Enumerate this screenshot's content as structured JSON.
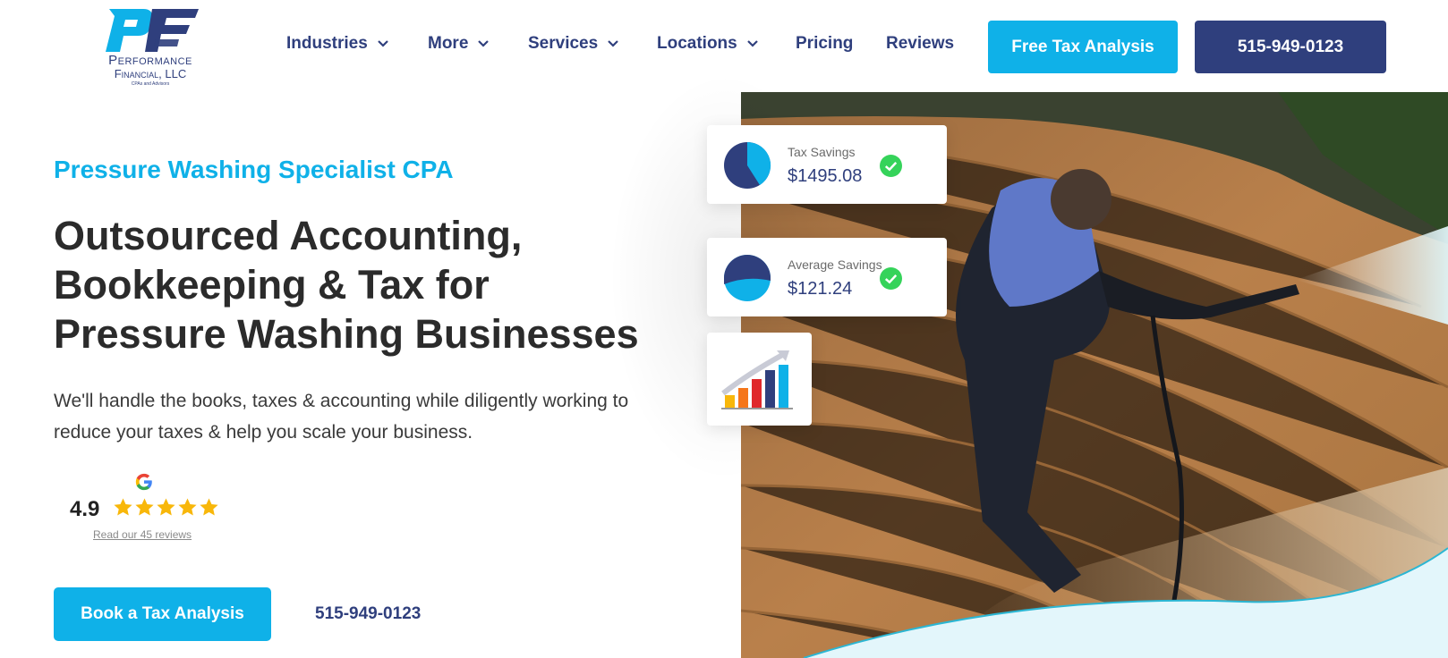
{
  "brand": {
    "name": "Performance",
    "subname": "Financial, LLC",
    "tagline": "CPAs and Advisors",
    "colors": {
      "navy": "#2f3f7d",
      "cyan": "#0fb1e8"
    }
  },
  "nav": {
    "items": [
      {
        "label": "Industries",
        "dropdown": true
      },
      {
        "label": "More",
        "dropdown": true
      },
      {
        "label": "Services",
        "dropdown": true
      },
      {
        "label": "Locations",
        "dropdown": true
      },
      {
        "label": "Pricing",
        "dropdown": false
      },
      {
        "label": "Reviews",
        "dropdown": false
      }
    ],
    "cta_label": "Free Tax Analysis",
    "phone_label": "515-949-0123"
  },
  "hero": {
    "eyebrow": "Pressure Washing Specialist CPA",
    "headline_lines": [
      "Outsourced Accounting,",
      "Bookkeeping & Tax for",
      "Pressure Washing Businesses"
    ],
    "intro": "We'll handle the books, taxes & accounting while diligently working to reduce your taxes & help you scale your business.",
    "rating": {
      "score": "4.9",
      "stars": 5,
      "source_icon": "google-icon",
      "link_text": "Read our 45 reviews"
    },
    "book_label": "Book a Tax Analysis",
    "phone": "515-949-0123"
  },
  "cards": [
    {
      "label": "Tax Savings",
      "value": "$1495.08",
      "icon": "pie-chart-icon",
      "status_icon": "check-circle-icon"
    },
    {
      "label": "Average Savings",
      "value": "$121.24",
      "icon": "pie-chart-icon",
      "status_icon": "check-circle-icon"
    },
    {
      "icon": "bar-chart-growth-icon"
    }
  ],
  "hero_image": {
    "subject": "photo-man-pressure-washing-deck"
  }
}
